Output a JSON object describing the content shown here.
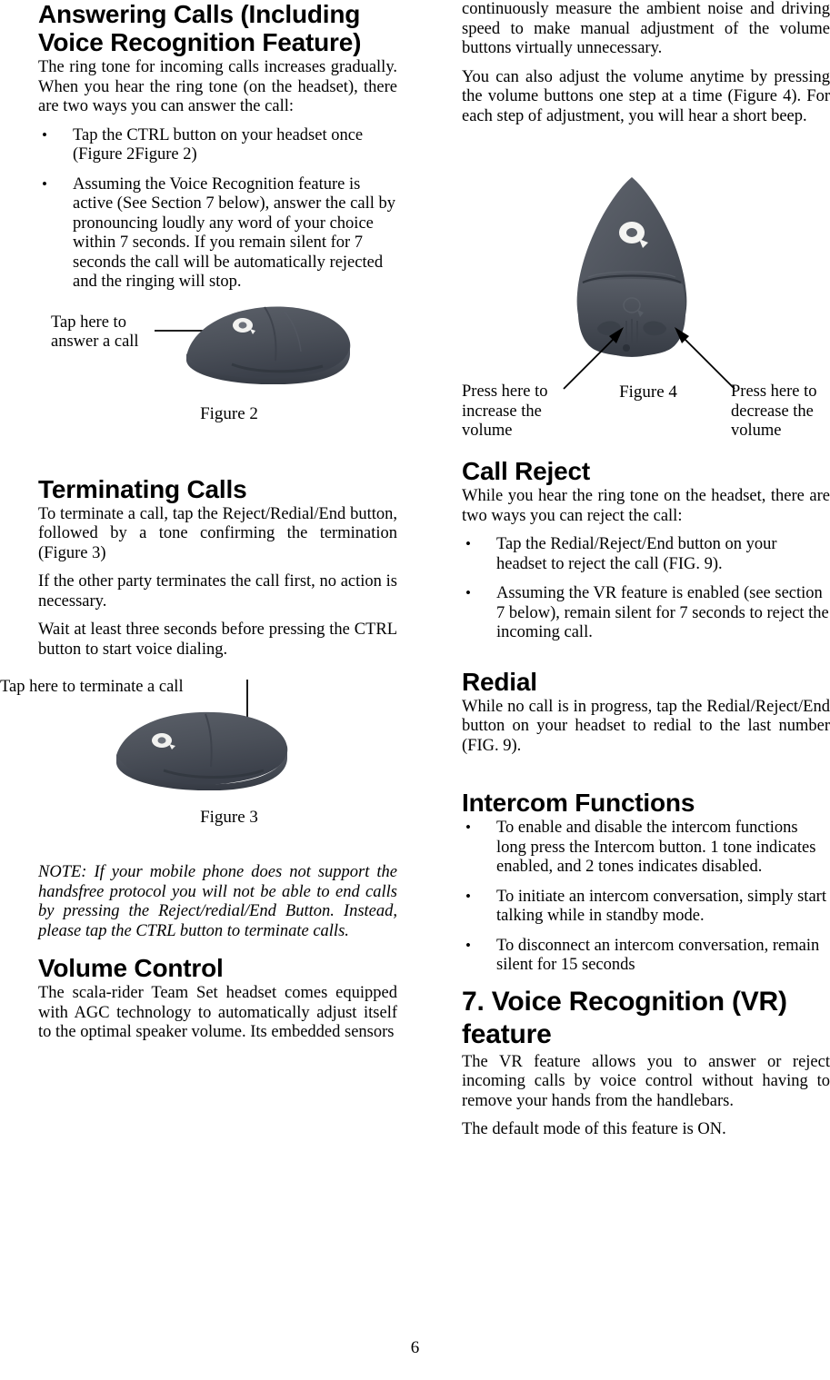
{
  "page": {
    "number": "6"
  },
  "left_column": {
    "heading_answering": "Answering Calls (Including Voice Recognition Feature)",
    "intro": "The ring tone for incoming calls increases gradually. When you hear the ring tone (on the headset), there are two ways you can answer the call:",
    "bullets": [
      "Tap the CTRL button on your headset once (Figure 2Figure 2)",
      "Assuming the Voice Recognition feature is active (See Section 7 below), answer the call by pronouncing loudly any word of your choice within 7 seconds. If you remain silent for 7 seconds the call will be automatically rejected and the ringing will stop."
    ],
    "figure2": {
      "label": "Tap here to answer a call",
      "caption": "Figure 2"
    },
    "heading_terminating": "Terminating Calls",
    "terminating_p1": "To terminate a call, tap the Reject/Redial/End button, followed by a tone confirming the termination (Figure 3)",
    "terminating_p2": "If the other party terminates the call first, no action is necessary.",
    "terminating_p3": "Wait at least three seconds before pressing the CTRL button to start voice dialing.",
    "figure3": {
      "label": "Tap here to terminate a call",
      "caption": "Figure 3"
    },
    "note": "NOTE: If your mobile phone does not support the handsfree protocol you will not be able to end calls by pressing the Reject/redial/End Button. Instead, please tap the CTRL button to terminate calls.",
    "heading_volume": "Volume Control",
    "volume_p1": "The scala-rider Team Set headset comes equipped with AGC technology to automatically adjust itself to the optimal speaker volume. Its embedded sensors"
  },
  "right_column": {
    "volume_cont": "continuously measure the ambient noise and driving speed to make manual adjustment of the volume buttons virtually unnecessary.",
    "volume_p2": "You can also adjust the volume anytime by pressing the volume buttons one step at a time (Figure 4). For each step of adjustment, you will hear a short beep.",
    "figure4": {
      "label_left": "Press here to increase the volume",
      "label_right": "Press here to decrease the volume",
      "caption": "Figure 4"
    },
    "heading_call_reject": "Call Reject",
    "call_reject_intro": "While you hear the ring tone on the headset, there are two ways you can reject the call:",
    "call_reject_bullets": [
      "Tap the Redial/Reject/End button on your headset to reject the call (FIG. 9).",
      "Assuming the VR feature is enabled (see section 7 below), remain silent for 7 seconds to reject the incoming call."
    ],
    "heading_redial": "Redial",
    "redial_p": "While no call is in progress, tap the Redial/Reject/End button on your headset to redial to the last number (FIG. 9).",
    "heading_intercom": "Intercom Functions",
    "intercom_bullets": [
      "To enable and disable the intercom functions long press the Intercom button. 1 tone indicates enabled, and 2 tones indicates disabled.",
      "To initiate an intercom conversation, simply start talking while in standby mode.",
      "To disconnect an intercom conversation, remain silent for 15 seconds"
    ],
    "heading_vr": "7. Voice Recognition (VR) feature",
    "vr_p1": "The VR feature allows you to answer or reject incoming calls by voice control without having to remove your hands from the handlebars.",
    "vr_p2": "The default mode of this feature is ON."
  },
  "colors": {
    "text": "#000000",
    "background": "#ffffff",
    "headset_body": "#4b5059",
    "headset_shadow": "#33383f",
    "headset_highlight": "#60656e"
  }
}
